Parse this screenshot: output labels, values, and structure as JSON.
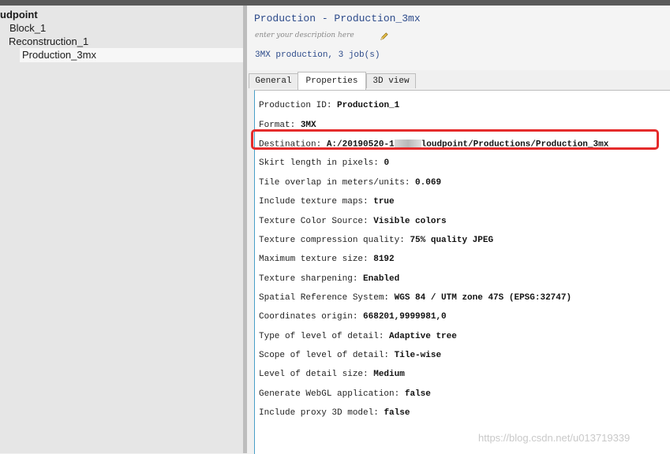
{
  "tree": [
    {
      "label": "udpoint",
      "bold": true
    },
    {
      "label": "Block_1"
    },
    {
      "label": "Reconstruction_1"
    },
    {
      "label": "Production_3mx",
      "selected": true
    }
  ],
  "header": {
    "title": "Production - Production_3mx",
    "description_placeholder": "enter your description here",
    "summary": "3MX production, 3 job(s)"
  },
  "tabs": [
    "General",
    "Properties",
    "3D view"
  ],
  "active_tab": "Properties",
  "properties": [
    {
      "label": "Production ID: ",
      "value": "Production_1"
    },
    {
      "label": "Format: ",
      "value": "3MX"
    },
    {
      "label": "Destination: ",
      "value_prefix": "A:/20190520-1",
      "value": "loudpoint/Productions/Production_3mx",
      "highlighted": true
    },
    {
      "label": "Skirt length in pixels: ",
      "value": "0"
    },
    {
      "label": "Tile overlap in meters/units: ",
      "value": "0.069"
    },
    {
      "label": "Include texture maps: ",
      "value": "true"
    },
    {
      "label": "Texture Color Source: ",
      "value": "Visible colors"
    },
    {
      "label": "Texture compression quality: ",
      "value": "75% quality JPEG"
    },
    {
      "label": "Maximum texture size: ",
      "value": "8192"
    },
    {
      "label": "Texture sharpening: ",
      "value": "Enabled"
    },
    {
      "label": "Spatial Reference System: ",
      "value": "WGS 84 / UTM zone 47S (EPSG:32747)"
    },
    {
      "label": "Coordinates origin: ",
      "value": "668201,9999981,0"
    },
    {
      "label": "Type of level of detail: ",
      "value": "Adaptive tree"
    },
    {
      "label": "Scope of level of detail: ",
      "value": "Tile-wise"
    },
    {
      "label": "Level of detail size: ",
      "value": "Medium"
    },
    {
      "label": "Generate WebGL application: ",
      "value": "false"
    },
    {
      "label": "Include proxy 3D model: ",
      "value": "false"
    }
  ],
  "watermark": "https://blog.csdn.net/u013719339",
  "colors": {
    "title": "#2c4a8a",
    "highlight_border": "#e52b2b",
    "content_border": "#4aa0c8"
  }
}
